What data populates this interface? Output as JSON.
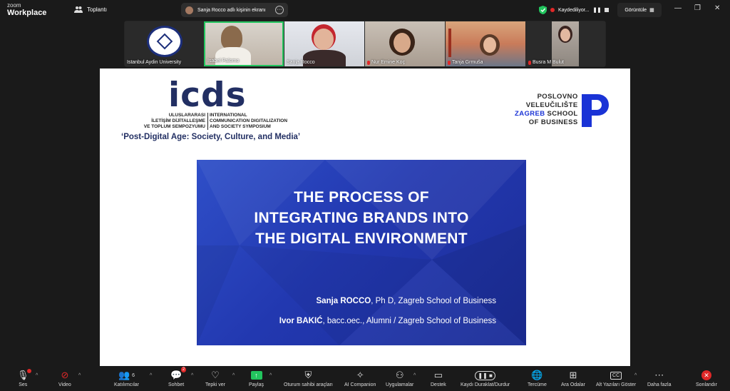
{
  "topbar": {
    "logo_line1": "zoom",
    "logo_line2": "Workplace",
    "meeting_label": "Toplantı",
    "share_text": "Sanja Rocco adlı kişinin ekranı",
    "share_more": "···",
    "recording_text": "Kaydediliyor...",
    "view_label": "Görüntüle",
    "win_min": "—",
    "win_max": "❐",
    "win_close": "✕"
  },
  "participants": [
    {
      "name": "Istanbul Aydin University",
      "muted": false
    },
    {
      "name": "Isabel Palomo",
      "muted": false
    },
    {
      "name": "Sanja Rocco",
      "muted": false
    },
    {
      "name": "Nur Emine Koç",
      "muted": true
    },
    {
      "name": "Tanja Grmuša",
      "muted": true
    },
    {
      "name": "Busra M Bulut",
      "muted": true
    }
  ],
  "slide": {
    "logo_text": "icds",
    "logo_tr": [
      "ULUSLARARASI",
      "İLETİŞİM DİJİTALLEŞME",
      "VE TOPLUM SEMPOZYUMU"
    ],
    "logo_en": [
      "INTERNATIONAL",
      "COMMUNICATION DIGITALIZATION",
      "AND SOCIETY SYMPOSIUM"
    ],
    "tagline": "‘Post-Digital Age: Society, Culture, and Media’",
    "school_l1": "POSLOVNO",
    "school_l2": "VELEUČILIŠTE",
    "school_l3a": "ZAGREB",
    "school_l3b": " SCHOOL",
    "school_l4": "OF BUSINESS",
    "title_l1": "THE PROCESS OF",
    "title_l2": "INTEGRATING BRANDS INTO",
    "title_l3": "THE DIGITAL ENVIRONMENT",
    "author1_name": "Sanja ROCCO",
    "author1_rest": ", Ph D, Zagreb School of Business",
    "author2_name": "Ivor BAKIĆ",
    "author2_rest": ", bacc.oec., Alumni / Zagreb School of Business"
  },
  "toolbar": {
    "audio": "Ses",
    "video": "Video",
    "participants": "Katılımcılar",
    "participants_count": "6",
    "chat": "Sohbet",
    "chat_badge": "2",
    "react": "Tepki ver",
    "share": "Paylaş",
    "host_tools": "Oturum sahibi araçları",
    "ai": "AI Companion",
    "apps": "Uygulamalar",
    "support": "Destek",
    "record": "Kaydı Duraklat/Durdur",
    "translate": "Tercüme",
    "breakout": "Ara Odalar",
    "captions": "Alt Yazıları Göster",
    "more": "Daha fazla",
    "end": "Sonlandır"
  },
  "colors": {
    "accent_green": "#22c55e",
    "danger": "#e02828",
    "slide_blue": "#2238b0",
    "brand_blue": "#1a33d6"
  }
}
